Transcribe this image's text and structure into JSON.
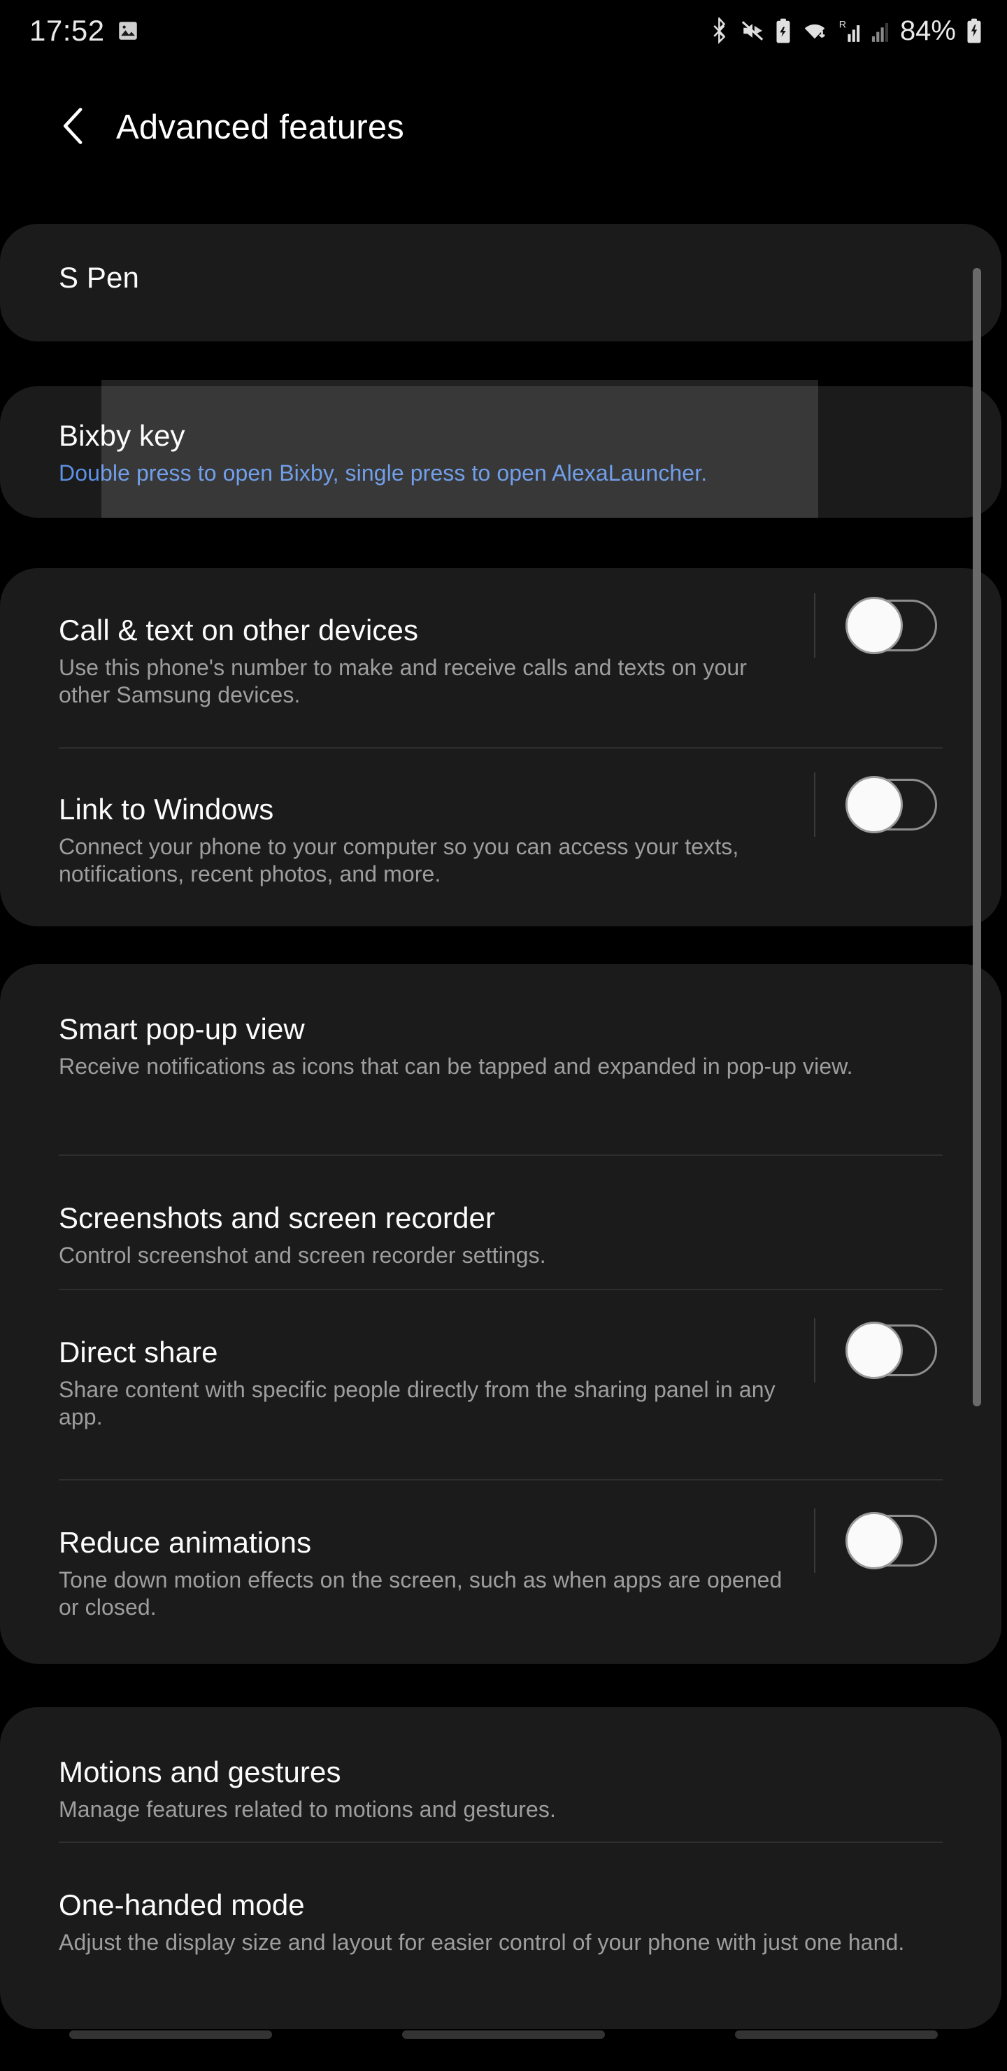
{
  "status_bar": {
    "time": "17:52",
    "battery_percent": "84%",
    "left_icons": [
      "image-icon"
    ],
    "right_icons": [
      "bluetooth-icon",
      "mute-icon",
      "battery-saver-icon",
      "wifi-icon",
      "roaming-signal-icon",
      "signal-icon",
      "charging-battery-icon"
    ]
  },
  "header": {
    "back_icon": "back-chevron-icon",
    "title": "Advanced features"
  },
  "sections": [
    {
      "id": "s-pen",
      "rows": [
        {
          "title": "S Pen",
          "subtitle": "",
          "toggle": null
        }
      ]
    },
    {
      "id": "bixby",
      "rows": [
        {
          "title": "Bixby key",
          "subtitle": "Double press to open Bixby, single press to open AlexaLauncher.",
          "subtitle_accent": true,
          "toggle": null
        }
      ]
    },
    {
      "id": "connections",
      "rows": [
        {
          "title": "Call & text on other devices",
          "subtitle": "Use this phone's number to make and receive calls and texts on your other Samsung devices.",
          "toggle": "off"
        },
        {
          "title": "Link to Windows",
          "subtitle": "Connect your phone to your computer so you can access your texts, notifications, recent photos, and more.",
          "toggle": "off"
        }
      ]
    },
    {
      "id": "display-extras",
      "rows": [
        {
          "title": "Smart pop-up view",
          "subtitle": "Receive notifications as icons that can be tapped and expanded in pop-up view.",
          "toggle": null
        },
        {
          "title": "Screenshots and screen recorder",
          "subtitle": "Control screenshot and screen recorder settings.",
          "toggle": null
        },
        {
          "title": "Direct share",
          "subtitle": "Share content with specific people directly from the sharing panel in any app.",
          "toggle": "off"
        },
        {
          "title": "Reduce animations",
          "subtitle": "Tone down motion effects on the screen, such as when apps are opened or closed.",
          "toggle": "off"
        }
      ]
    },
    {
      "id": "motions",
      "rows": [
        {
          "title": "Motions and gestures",
          "subtitle": "Manage features related to motions and gestures.",
          "toggle": null
        },
        {
          "title": "One-handed mode",
          "subtitle": "Adjust the display size and layout for easier control of your phone with just one hand.",
          "toggle": null
        }
      ]
    }
  ],
  "colors": {
    "background": "#000000",
    "card": "#1b1b1b",
    "title_text": "#fcfcfc",
    "subtitle_text": "#9e9e9e",
    "accent_blue": "#5c91e6",
    "divider": "#2e2e2e",
    "scrollbar": "#6a6a6a"
  },
  "navbar": {
    "pills": [
      "recents-pill",
      "home-pill",
      "back-pill"
    ]
  }
}
